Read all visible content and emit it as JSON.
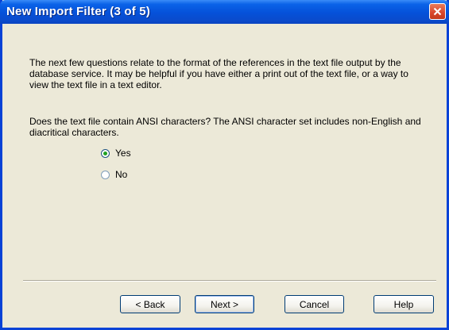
{
  "window": {
    "title": "New Import Filter (3 of 5)"
  },
  "body": {
    "paragraph1": "The next few questions relate to the format of the references in the text file output by the database service.  It may be helpful if you have either a print out of the text file, or a way to view the text file in a text editor.",
    "paragraph2": "Does the text file contain ANSI characters?  The ANSI character set includes non-English and diacritical characters."
  },
  "options": [
    {
      "label": "Yes",
      "selected": true
    },
    {
      "label": "No",
      "selected": false
    }
  ],
  "buttons": {
    "back": "< Back",
    "next": "Next >",
    "cancel": "Cancel",
    "help": "Help"
  },
  "colors": {
    "titlebar": "#0551d9",
    "dialog_bg": "#ece9d8",
    "close_button": "#d8452a"
  },
  "icons": {
    "close": "close-icon"
  }
}
